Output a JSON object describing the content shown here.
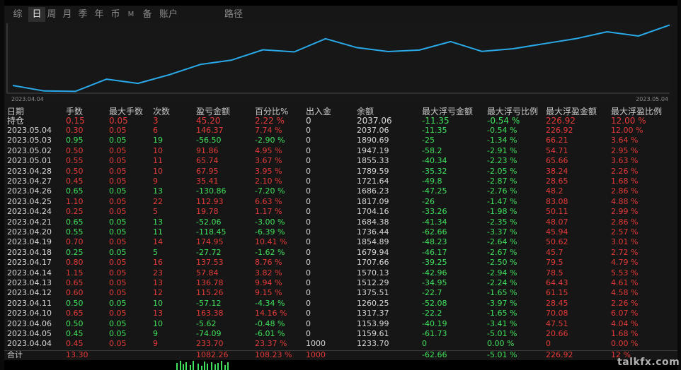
{
  "tabs": [
    {
      "label": "综",
      "active": false
    },
    {
      "label": "日",
      "active": true
    },
    {
      "label": "周",
      "active": false
    },
    {
      "label": "月",
      "active": false
    },
    {
      "label": "季",
      "active": false
    },
    {
      "label": "年",
      "active": false
    },
    {
      "label": "币",
      "active": false
    },
    {
      "label": "M",
      "active": false
    },
    {
      "label": "备",
      "active": false
    },
    {
      "label": "账户",
      "active": false
    },
    {
      "label": "路径",
      "active": false
    }
  ],
  "equity_chart": {
    "start_date": "2023.04.04",
    "end_date": "2023.05.04",
    "line_color": "#29a9e8",
    "balance_series": [
      1233.7,
      1159.61,
      1153.99,
      1317.37,
      1260.25,
      1375.51,
      1512.29,
      1570.13,
      1707.66,
      1679.94,
      1854.89,
      1736.44,
      1684.38,
      1704.16,
      1817.09,
      1686.23,
      1721.64,
      1789.59,
      1855.33,
      1947.19,
      1890.69,
      2037.06
    ]
  },
  "table": {
    "columns": [
      "日期",
      "手数",
      "最大手数",
      "次数",
      "盈亏金额",
      "百分比%",
      "出入金",
      "余额",
      "最大浮亏金额",
      "最大浮亏比例",
      "最大浮盈金额",
      "最大浮盈比例"
    ],
    "holding": {
      "date": "持仓",
      "lots": "0.15",
      "max_lots": "0.05",
      "count": "3",
      "pnl": "45.20",
      "pct": "2.22 %",
      "flow": "0",
      "balance": "2037.06",
      "max_fl": "-11.35",
      "max_fl_pct": "-0.54 %",
      "max_fp": "226.92",
      "max_fp_pct": "12.00 %",
      "color": "red"
    },
    "rows": [
      {
        "date": "2023.05.04",
        "lots": "0.30",
        "max_lots": "0.05",
        "count": "6",
        "pnl": "146.37",
        "pct": "7.74 %",
        "flow": "0",
        "balance": "2037.06",
        "max_fl": "-11.35",
        "max_fl_pct": "-0.54 %",
        "max_fp": "226.92",
        "max_fp_pct": "12.00 %",
        "color": "red"
      },
      {
        "date": "2023.05.03",
        "lots": "0.95",
        "max_lots": "0.05",
        "count": "19",
        "pnl": "-56.50",
        "pct": "-2.90 %",
        "flow": "0",
        "balance": "1890.69",
        "max_fl": "-25",
        "max_fl_pct": "-1.34 %",
        "max_fp": "66.21",
        "max_fp_pct": "3.64 %",
        "color": "green"
      },
      {
        "date": "2023.05.02",
        "lots": "0.50",
        "max_lots": "0.05",
        "count": "10",
        "pnl": "91.86",
        "pct": "4.95 %",
        "flow": "0",
        "balance": "1947.19",
        "max_fl": "-58.2",
        "max_fl_pct": "-2.91 %",
        "max_fp": "54.71",
        "max_fp_pct": "2.95 %",
        "color": "red"
      },
      {
        "date": "2023.05.01",
        "lots": "0.55",
        "max_lots": "0.05",
        "count": "11",
        "pnl": "65.74",
        "pct": "3.67 %",
        "flow": "0",
        "balance": "1855.33",
        "max_fl": "-40.34",
        "max_fl_pct": "-2.23 %",
        "max_fp": "65.66",
        "max_fp_pct": "3.63 %",
        "color": "red"
      },
      {
        "date": "2023.04.28",
        "lots": "0.50",
        "max_lots": "0.05",
        "count": "10",
        "pnl": "67.95",
        "pct": "3.95 %",
        "flow": "0",
        "balance": "1789.59",
        "max_fl": "-35.32",
        "max_fl_pct": "-2.05 %",
        "max_fp": "38.24",
        "max_fp_pct": "2.26 %",
        "color": "red"
      },
      {
        "date": "2023.04.27",
        "lots": "0.45",
        "max_lots": "0.05",
        "count": "9",
        "pnl": "35.41",
        "pct": "2.10 %",
        "flow": "0",
        "balance": "1721.64",
        "max_fl": "-49.8",
        "max_fl_pct": "-2.87 %",
        "max_fp": "28.65",
        "max_fp_pct": "1.68 %",
        "color": "red"
      },
      {
        "date": "2023.04.26",
        "lots": "0.65",
        "max_lots": "0.05",
        "count": "13",
        "pnl": "-130.86",
        "pct": "-7.20 %",
        "flow": "0",
        "balance": "1686.23",
        "max_fl": "-47.25",
        "max_fl_pct": "-2.76 %",
        "max_fp": "48.2",
        "max_fp_pct": "2.86 %",
        "color": "green"
      },
      {
        "date": "2023.04.25",
        "lots": "1.10",
        "max_lots": "0.05",
        "count": "22",
        "pnl": "112.93",
        "pct": "6.63 %",
        "flow": "0",
        "balance": "1817.09",
        "max_fl": "-26",
        "max_fl_pct": "-1.47 %",
        "max_fp": "83.08",
        "max_fp_pct": "4.88 %",
        "color": "red"
      },
      {
        "date": "2023.04.24",
        "lots": "0.25",
        "max_lots": "0.05",
        "count": "5",
        "pnl": "19.78",
        "pct": "1.17 %",
        "flow": "0",
        "balance": "1704.16",
        "max_fl": "-33.26",
        "max_fl_pct": "-1.98 %",
        "max_fp": "50.11",
        "max_fp_pct": "2.99 %",
        "color": "red"
      },
      {
        "date": "2023.04.21",
        "lots": "0.65",
        "max_lots": "0.05",
        "count": "13",
        "pnl": "-52.06",
        "pct": "-3.00 %",
        "flow": "0",
        "balance": "1684.38",
        "max_fl": "-41.34",
        "max_fl_pct": "-2.35 %",
        "max_fp": "48.07",
        "max_fp_pct": "2.86 %",
        "color": "green"
      },
      {
        "date": "2023.04.20",
        "lots": "0.55",
        "max_lots": "0.05",
        "count": "11",
        "pnl": "-118.45",
        "pct": "-6.39 %",
        "flow": "0",
        "balance": "1736.44",
        "max_fl": "-62.66",
        "max_fl_pct": "-3.37 %",
        "max_fp": "45.94",
        "max_fp_pct": "2.57 %",
        "color": "green"
      },
      {
        "date": "2023.04.19",
        "lots": "0.70",
        "max_lots": "0.05",
        "count": "14",
        "pnl": "174.95",
        "pct": "10.41 %",
        "flow": "0",
        "balance": "1854.89",
        "max_fl": "-48.23",
        "max_fl_pct": "-2.64 %",
        "max_fp": "50.62",
        "max_fp_pct": "3.01 %",
        "color": "red"
      },
      {
        "date": "2023.04.18",
        "lots": "0.25",
        "max_lots": "0.05",
        "count": "5",
        "pnl": "-27.72",
        "pct": "-1.62 %",
        "flow": "0",
        "balance": "1679.94",
        "max_fl": "-46.17",
        "max_fl_pct": "-2.67 %",
        "max_fp": "45.7",
        "max_fp_pct": "2.72 %",
        "color": "green"
      },
      {
        "date": "2023.04.17",
        "lots": "0.80",
        "max_lots": "0.05",
        "count": "16",
        "pnl": "137.53",
        "pct": "8.76 %",
        "flow": "0",
        "balance": "1707.66",
        "max_fl": "-39.25",
        "max_fl_pct": "-2.50 %",
        "max_fp": "79.5",
        "max_fp_pct": "4.79 %",
        "color": "red"
      },
      {
        "date": "2023.04.14",
        "lots": "1.15",
        "max_lots": "0.05",
        "count": "23",
        "pnl": "57.84",
        "pct": "3.82 %",
        "flow": "0",
        "balance": "1570.13",
        "max_fl": "-42.96",
        "max_fl_pct": "-2.94 %",
        "max_fp": "78.5",
        "max_fp_pct": "5.53 %",
        "color": "red"
      },
      {
        "date": "2023.04.13",
        "lots": "0.65",
        "max_lots": "0.05",
        "count": "13",
        "pnl": "136.78",
        "pct": "9.94 %",
        "flow": "0",
        "balance": "1512.29",
        "max_fl": "-34.95",
        "max_fl_pct": "-2.24 %",
        "max_fp": "64.43",
        "max_fp_pct": "4.61 %",
        "color": "red"
      },
      {
        "date": "2023.04.12",
        "lots": "0.60",
        "max_lots": "0.05",
        "count": "12",
        "pnl": "115.26",
        "pct": "9.15 %",
        "flow": "0",
        "balance": "1375.51",
        "max_fl": "-22.7",
        "max_fl_pct": "-1.65 %",
        "max_fp": "61.15",
        "max_fp_pct": "4.58 %",
        "color": "red"
      },
      {
        "date": "2023.04.11",
        "lots": "0.50",
        "max_lots": "0.05",
        "count": "10",
        "pnl": "-57.12",
        "pct": "-4.34 %",
        "flow": "0",
        "balance": "1260.25",
        "max_fl": "-52.08",
        "max_fl_pct": "-3.97 %",
        "max_fp": "28.45",
        "max_fp_pct": "2.26 %",
        "color": "green"
      },
      {
        "date": "2023.04.10",
        "lots": "0.65",
        "max_lots": "0.05",
        "count": "13",
        "pnl": "163.38",
        "pct": "14.16 %",
        "flow": "0",
        "balance": "1317.37",
        "max_fl": "-22.2",
        "max_fl_pct": "-1.65 %",
        "max_fp": "70.08",
        "max_fp_pct": "6.07 %",
        "color": "red"
      },
      {
        "date": "2023.04.06",
        "lots": "0.50",
        "max_lots": "0.05",
        "count": "10",
        "pnl": "-5.62",
        "pct": "-0.48 %",
        "flow": "0",
        "balance": "1153.99",
        "max_fl": "-40.19",
        "max_fl_pct": "-3.41 %",
        "max_fp": "47.51",
        "max_fp_pct": "4.04 %",
        "color": "green"
      },
      {
        "date": "2023.04.05",
        "lots": "0.45",
        "max_lots": "0.05",
        "count": "9",
        "pnl": "-74.09",
        "pct": "-6.01 %",
        "flow": "0",
        "balance": "1159.61",
        "max_fl": "-61.73",
        "max_fl_pct": "-5.01 %",
        "max_fp": "20.66",
        "max_fp_pct": "1.68 %",
        "color": "green"
      },
      {
        "date": "2023.04.04",
        "lots": "0.45",
        "max_lots": "0.05",
        "count": "9",
        "pnl": "233.70",
        "pct": "23.37 %",
        "flow": "1000",
        "balance": "1233.70",
        "max_fl": "0",
        "max_fl_pct": "0.00 %",
        "max_fp": "0",
        "max_fp_pct": "0.00 %",
        "color": "red"
      }
    ],
    "total": {
      "label": "合计",
      "lots": "13.30",
      "pnl": "1082.26",
      "pct": "108.23 %",
      "flow": "1000",
      "max_fl": "-62.66",
      "max_fl_pct": "-5.01 %",
      "max_fp": "226.92",
      "max_fp_pct": "12 %"
    }
  },
  "watermark": "talkfx.com",
  "colors": {
    "profit": "#e63a3a",
    "loss": "#3fe05c",
    "text": "#d8d8d8",
    "background": "#000000",
    "line": "#29a9e8"
  }
}
